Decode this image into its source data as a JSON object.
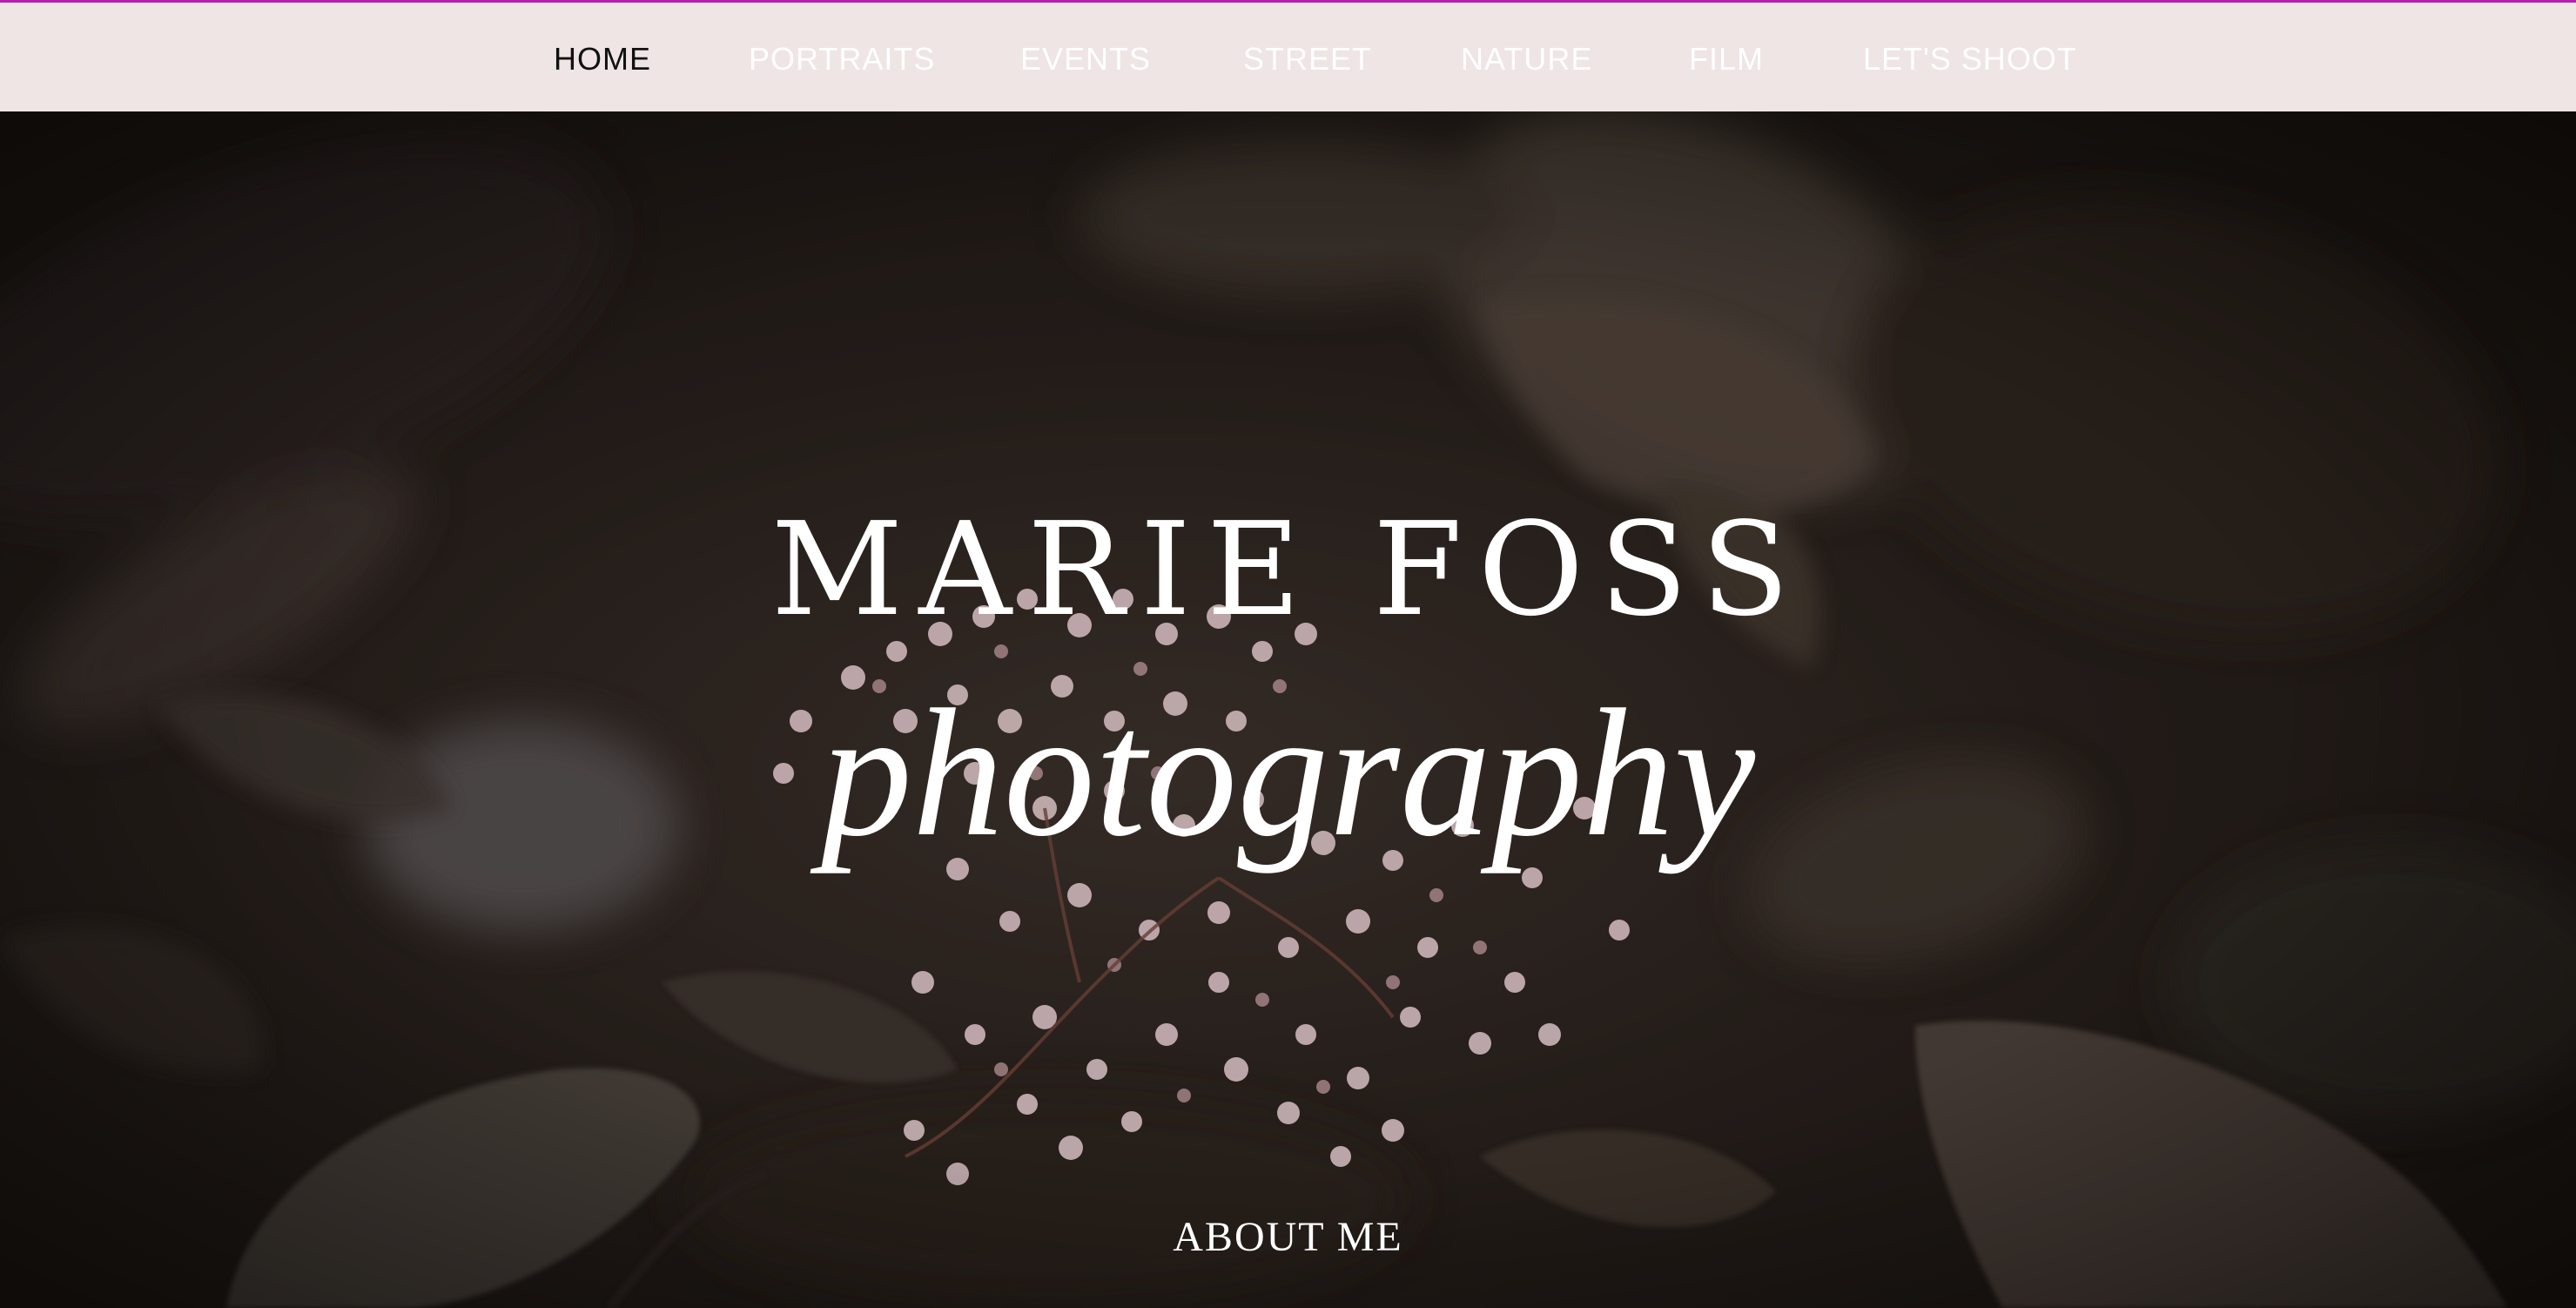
{
  "nav": {
    "items": [
      {
        "label": "HOME",
        "active": true
      },
      {
        "label": "PORTRAITS",
        "active": false
      },
      {
        "label": "EVENTS",
        "active": false
      },
      {
        "label": "STREET",
        "active": false
      },
      {
        "label": "NATURE",
        "active": false
      },
      {
        "label": "FILM",
        "active": false
      },
      {
        "label": "LET'S SHOOT",
        "active": false
      }
    ]
  },
  "hero": {
    "title": "MARIE FOSS",
    "subtitle": "photography",
    "about_label": "ABOUT ME"
  },
  "colors": {
    "accent_line": "#b51fb0",
    "nav_background": "#efe5e5",
    "nav_text": "#ffffff",
    "nav_active_text": "#111111",
    "hero_text": "#ffffff",
    "flower_pink": "#e8cfd3"
  }
}
